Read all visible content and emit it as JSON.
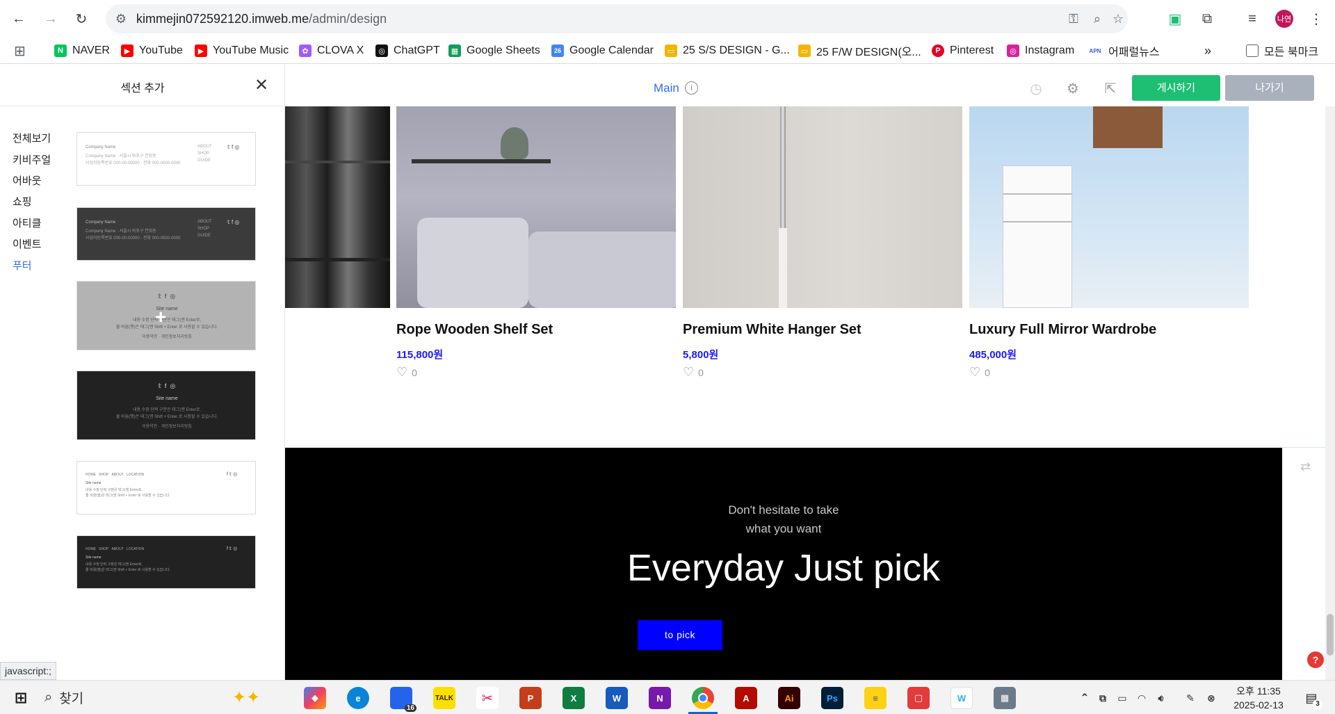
{
  "browser": {
    "url_host": "kimmejin072592120.imweb.me",
    "url_path": "/admin/design",
    "profile_badge": "나연"
  },
  "bookmarks": [
    {
      "label": "NAVER",
      "color": "#03c75a",
      "glyph": "N"
    },
    {
      "label": "YouTube",
      "color": "#ff0000",
      "glyph": "▶"
    },
    {
      "label": "YouTube Music",
      "color": "#ff0000",
      "glyph": "▶"
    },
    {
      "label": "CLOVA X",
      "color": "#a259ff",
      "glyph": "✿"
    },
    {
      "label": "ChatGPT",
      "color": "#111111",
      "glyph": "◎"
    },
    {
      "label": "Google Sheets",
      "color": "#0f9d58",
      "glyph": "▦"
    },
    {
      "label": "Google Calendar",
      "color": "#4285f4",
      "glyph": "26"
    },
    {
      "label": "25 S/S DESIGN - G...",
      "color": "#f4b400",
      "glyph": "▭"
    },
    {
      "label": "25 F/W DESIGN(오...",
      "color": "#f4b400",
      "glyph": "▭"
    },
    {
      "label": "Pinterest",
      "color": "#e60023",
      "glyph": "P"
    },
    {
      "label": "Instagram",
      "color": "#d6249f",
      "glyph": "◎"
    },
    {
      "label": "어패럴뉴스",
      "color": "#3b5bdb",
      "glyph": "APN"
    },
    {
      "label": "모든 북마크",
      "color": "#5f6368",
      "glyph": "▢"
    }
  ],
  "panel": {
    "title": "섹션 추가",
    "categories": [
      "전체보기",
      "키비주얼",
      "어바웃",
      "쇼핑",
      "아티클",
      "이벤트",
      "푸터"
    ],
    "active_category": "푸터",
    "thumb_text": {
      "company_name": "Company Name",
      "address": "Company Name · 서울시 마포구 연희동",
      "business": "사업자등록번호 000-00-00000 · 전화 000-0000-0000",
      "menu": [
        "ABOUT",
        "SHOP",
        "GUIDE"
      ],
      "site_name": "Site name",
      "desc1": "내용 수정 단락 구분은 태그(엔 Enter로,",
      "desc2": "줄 바꿈(행)은 태그(엔 Shift + Enter 로 사용할 수 있습니다.",
      "links": "이용약관 · 개인정보처리방침",
      "nav": [
        "HOME",
        "SHOP",
        "ABOUT",
        "LOCATION"
      ]
    }
  },
  "editor": {
    "page_name": "Main",
    "publish_label": "게시하기",
    "exit_label": "나가기",
    "products": [
      {
        "name": "Rope Wooden Shelf Set",
        "price": "115,800원",
        "likes": "0"
      },
      {
        "name": "Premium White Hanger Set",
        "price": "5,800원",
        "likes": "0"
      },
      {
        "name": "Luxury Full Mirror Wardrobe",
        "price": "485,000원",
        "likes": "0"
      }
    ],
    "banner": {
      "sub_line1": "Don't hesitate to take",
      "sub_line2": "what you want",
      "title": "Everyday Just pick",
      "button": "to pick"
    }
  },
  "status_bar": "javascript:;",
  "taskbar": {
    "search_placeholder": "찾기",
    "clock_time": "오후 11:35",
    "clock_date": "2025-02-13",
    "notification_count": "3",
    "file_explorer_badge": "16"
  },
  "colors": {
    "accent": "#2f6ee7",
    "publish": "#1fbf73",
    "exit": "#a9b1bd",
    "price": "#1a1aff",
    "cta": "#0000ff"
  }
}
